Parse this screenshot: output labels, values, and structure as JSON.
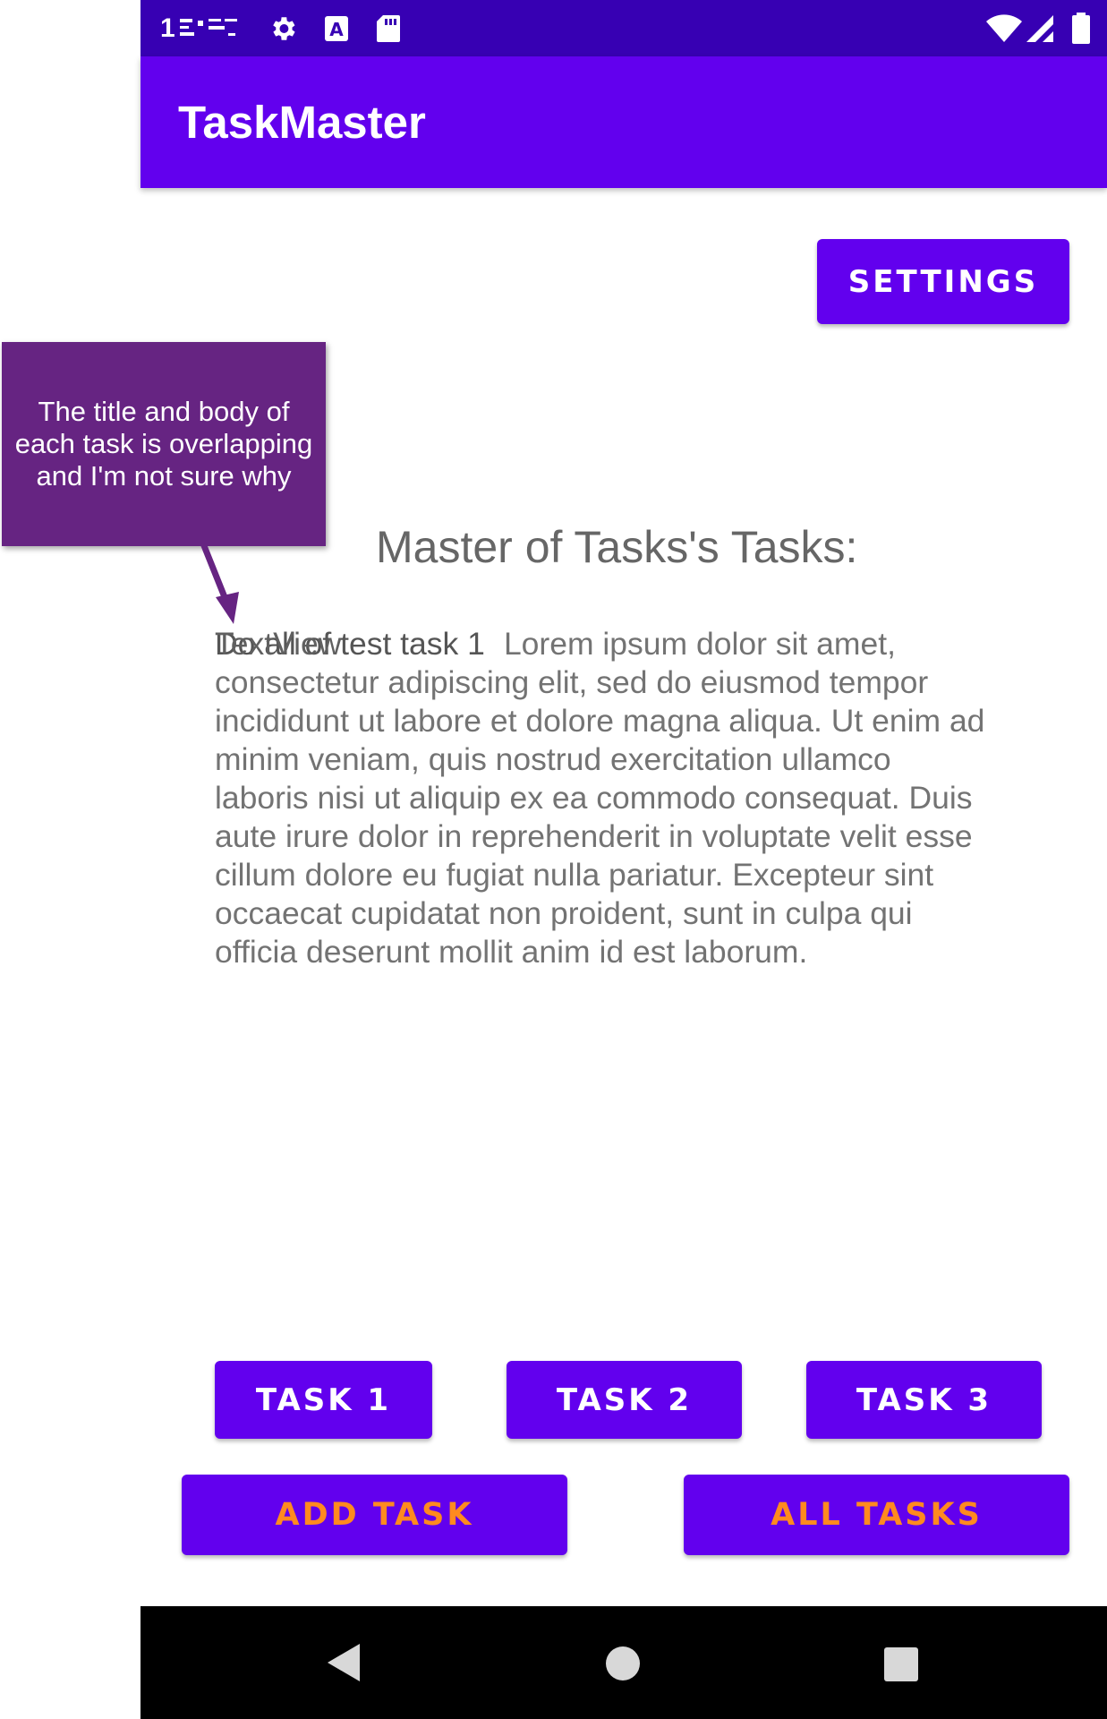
{
  "status_bar": {
    "time": "1",
    "icons": [
      "notification-icons",
      "gear-icon",
      "a-badge-icon",
      "sd-card-icon",
      "wifi-icon",
      "signal-icon",
      "battery-icon"
    ]
  },
  "app_bar": {
    "title": "TaskMaster"
  },
  "main": {
    "settings_label": "SETTINGS",
    "heading": "Master of Tasks's Tasks:",
    "task_title": "Do all of test task 1",
    "task_textview": "TextView",
    "task_body": "Lorem ipsum dolor sit amet, consectetur adipiscing elit, sed do eiusmod tempor incididunt ut labore et dolore magna aliqua. Ut enim ad minim veniam, quis nostrud exercitation ullamco laboris nisi ut aliquip ex ea commodo consequat. Duis aute irure dolor in reprehenderit in voluptate velit esse cillum dolore eu fugiat nulla pariatur. Excepteur sint occaecat cupidatat non proident, sunt in culpa qui officia deserunt mollit anim id est laborum."
  },
  "buttons": {
    "task1": "TASK 1",
    "task2": "TASK 2",
    "task3": "TASK 3",
    "add_task": "ADD TASK",
    "all_tasks": "ALL TASKS"
  },
  "nav_bar": {
    "icons": [
      "back-icon",
      "home-icon",
      "recents-icon"
    ]
  },
  "annotation": {
    "text": "The title and body of each task is overlapping and I'm not sure why"
  },
  "colors": {
    "status_bar": "#3700b3",
    "primary": "#6200ee",
    "accent_text": "#ff8a1f",
    "callout": "#662482"
  }
}
